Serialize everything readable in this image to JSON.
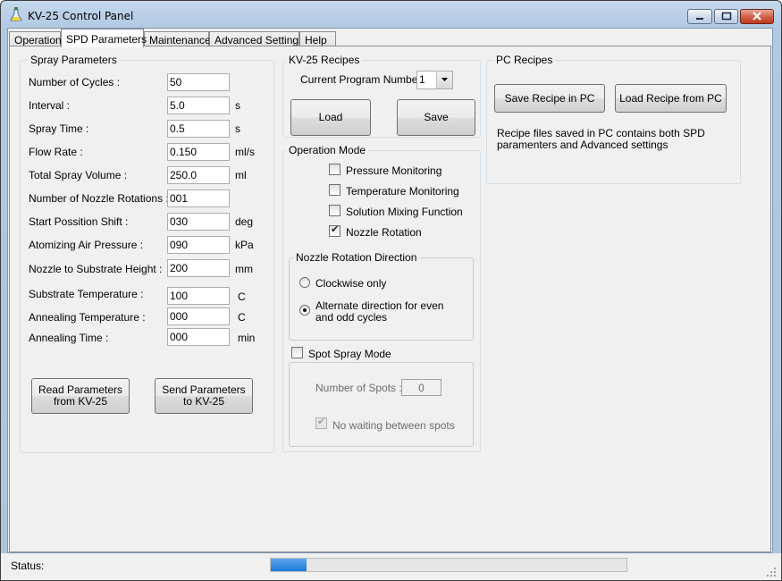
{
  "window": {
    "title": "KV-25 Control Panel"
  },
  "tabs": [
    "Operation",
    "SPD Parameters",
    "Maintenance",
    "Advanced Settings",
    "Help"
  ],
  "spray_parameters": {
    "title": "Spray Parameters",
    "rows": [
      {
        "label": "Number of Cycles :",
        "value": "50",
        "unit": ""
      },
      {
        "label": "Interval :",
        "value": "5.0",
        "unit": "s"
      },
      {
        "label": "Spray Time :",
        "value": "0.5",
        "unit": "s"
      },
      {
        "label": "Flow Rate :",
        "value": "0.150",
        "unit": "ml/s"
      },
      {
        "label": "Total Spray Volume :",
        "value": "250.0",
        "unit": "ml"
      },
      {
        "label": "Number of Nozzle Rotations :",
        "value": "001",
        "unit": ""
      },
      {
        "label": "Start Possition Shift :",
        "value": "030",
        "unit": "deg"
      },
      {
        "label": "Atomizing Air Pressure :",
        "value": "090",
        "unit": "kPa"
      },
      {
        "label": "Nozzle to Substrate Height :",
        "value": "200",
        "unit": "mm"
      },
      {
        "label": "Substrate Temperature :",
        "value": "100",
        "unit": "C"
      },
      {
        "label": "Annealing Temperature :",
        "value": "000",
        "unit": "C"
      },
      {
        "label": "Annealing Time :",
        "value": "000",
        "unit": "min"
      }
    ],
    "read_button": "Read Parameters from KV-25",
    "send_button": "Send Parameters to KV-25"
  },
  "kv_recipes": {
    "title": "KV-25 Recipes",
    "program_label": "Current Program Number :",
    "program_value": "1",
    "load_button": "Load",
    "save_button": "Save"
  },
  "operation_mode": {
    "title": "Operation Mode",
    "options": [
      {
        "label": "Pressure Monitoring",
        "checked": false
      },
      {
        "label": "Temperature Monitoring",
        "checked": false
      },
      {
        "label": "Solution Mixing Function",
        "checked": false
      },
      {
        "label": "Nozzle Rotation",
        "checked": true
      }
    ]
  },
  "nozzle_direction": {
    "title": "Nozzle Rotation Direction",
    "options": [
      {
        "label": "Clockwise only",
        "selected": false
      },
      {
        "label": "Alternate direction for even and odd cycles",
        "selected": true
      }
    ]
  },
  "spot_spray": {
    "label": "Spot Spray Mode",
    "checked": false,
    "spots_label": "Number of Spots :",
    "spots_value": "0",
    "no_wait_label": "No waiting between spots",
    "no_wait_checked": true
  },
  "pc_recipes": {
    "title": "PC Recipes",
    "save_button": "Save Recipe in PC",
    "load_button": "Load Recipe from PC",
    "info": "Recipe files saved in PC contains both SPD paramenters and Advanced settings"
  },
  "status": {
    "label": "Status:",
    "progress": 0.1
  },
  "colors": {
    "progress": "#1f79d5",
    "close_button": "#c13a20"
  }
}
